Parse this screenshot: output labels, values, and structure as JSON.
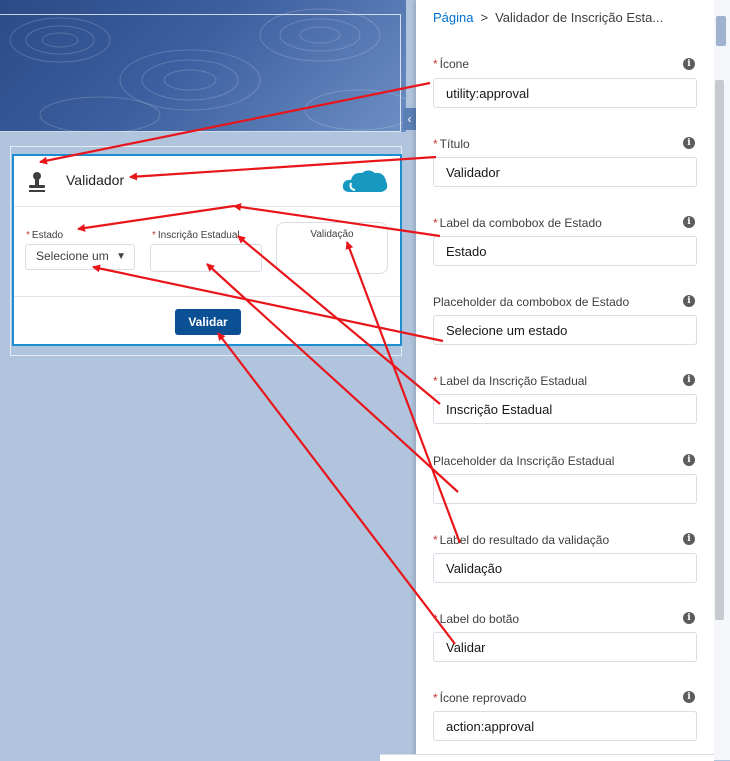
{
  "breadcrumb": {
    "root": "Página",
    "separator": ">",
    "current": "Validador de Inscrição Esta..."
  },
  "card": {
    "title": "Validador",
    "estado_label": "Estado",
    "estado_placeholder": "Selecione um",
    "ie_label": "Inscrição Estadual",
    "result_label": "Validação",
    "button_label": "Validar",
    "required_mark": "*"
  },
  "properties": [
    {
      "label": "Ícone",
      "required": true,
      "value": "utility:approval"
    },
    {
      "label": "Título",
      "required": true,
      "value": "Validador"
    },
    {
      "label": "Label da combobox de Estado",
      "required": true,
      "value": "Estado"
    },
    {
      "label": "Placeholder da combobox de Estado",
      "required": false,
      "value": "Selecione um estado"
    },
    {
      "label": "Label da Inscrição Estadual",
      "required": true,
      "value": "Inscrição Estadual"
    },
    {
      "label": "Placeholder da Inscrição Estadual",
      "required": false,
      "value": ""
    },
    {
      "label": "Label do resultado da validação",
      "required": true,
      "value": "Validação"
    },
    {
      "label": "Label do botão",
      "required": true,
      "value": "Validar"
    },
    {
      "label": "Ícone reprovado",
      "required": true,
      "value": "action:approval"
    }
  ],
  "colors": {
    "accent": "#0070d2",
    "button": "#0b4f95",
    "required": "#c23934",
    "annotation_arrow": "#e8161b",
    "canvas_background": "#b0c4de"
  },
  "icons": {
    "card_icon": "approval-stamp-icon",
    "brand_logo": "salesforce-cloud-icon",
    "info": "info-icon",
    "dropdown": "chevron-down-icon"
  }
}
